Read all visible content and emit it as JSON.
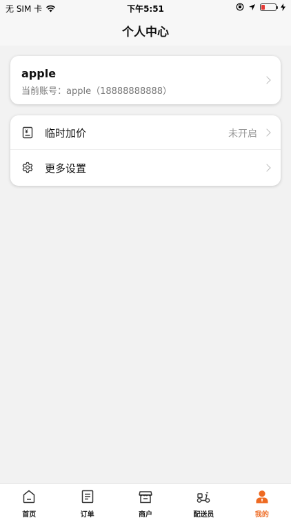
{
  "status_bar": {
    "carrier": "无 SIM 卡",
    "time": "下午5:51"
  },
  "nav": {
    "title": "个人中心"
  },
  "profile": {
    "name": "apple",
    "account_label": "当前账号：apple（18888888888）"
  },
  "menu": {
    "items": [
      {
        "label": "临时加价",
        "value": "未开启",
        "icon": "price-tag-icon"
      },
      {
        "label": "更多设置",
        "value": "",
        "icon": "gear-icon"
      }
    ]
  },
  "tabs": [
    {
      "label": "首页",
      "icon": "home-icon",
      "active": false
    },
    {
      "label": "订单",
      "icon": "order-list-icon",
      "active": false
    },
    {
      "label": "商户",
      "icon": "store-icon",
      "active": false
    },
    {
      "label": "配送员",
      "icon": "scooter-icon",
      "active": false
    },
    {
      "label": "我的",
      "icon": "user-icon",
      "active": true
    }
  ],
  "colors": {
    "accent": "#ee6a22",
    "background": "#f2f2f2"
  }
}
